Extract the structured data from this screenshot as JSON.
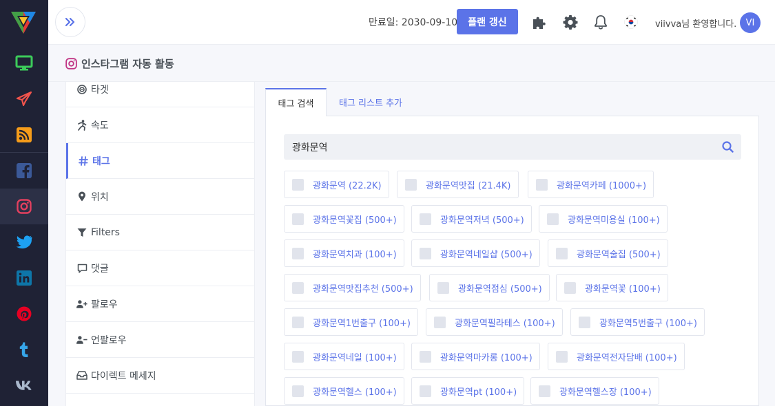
{
  "header": {
    "expiry_text": "만료일: 2030-09-10",
    "renew_label": "플랜 갱신",
    "welcome_text": "viivva님 환영합니다.",
    "avatar_initials": "VI"
  },
  "page": {
    "title": "인스타그램 자동 활동"
  },
  "subnav": [
    {
      "label": "타겟",
      "icon": "target-icon"
    },
    {
      "label": "속도",
      "icon": "running-icon"
    },
    {
      "label": "태그",
      "icon": "hashtag-icon",
      "active": true
    },
    {
      "label": "위치",
      "icon": "map-marker-icon"
    },
    {
      "label": "Filters",
      "icon": "filter-icon"
    },
    {
      "label": "댓글",
      "icon": "comment-icon"
    },
    {
      "label": "팔로우",
      "icon": "user-plus-icon"
    },
    {
      "label": "언팔로우",
      "icon": "user-minus-icon"
    },
    {
      "label": "다이렉트 메세지",
      "icon": "inbox-icon"
    }
  ],
  "tabs": [
    {
      "label": "태그 검색",
      "active": true
    },
    {
      "label": "태그 리스트 추가"
    }
  ],
  "search": {
    "value": "광화문역"
  },
  "tags": [
    "광화문역 (22.2K)",
    "광화문역맛집 (21.4K)",
    "광화문역카페 (1000+)",
    "광화문역꽃집 (500+)",
    "광화문역저녁 (500+)",
    "광화문역미용실 (100+)",
    "광화문역치과 (100+)",
    "광화문역네일샵 (500+)",
    "광화문역술집 (500+)",
    "광화문역맛집추천 (500+)",
    "광화문역점심 (500+)",
    "광화문역꽃 (100+)",
    "광화문역1번출구 (100+)",
    "광화문역필라테스 (100+)",
    "광화문역5번출구 (100+)",
    "광화문역네일 (100+)",
    "광화문역마카롱 (100+)",
    "광화문역전자담배 (100+)",
    "광화문역헬스 (100+)",
    "광화문역pt (100+)",
    "광화문역헬스장 (100+)"
  ],
  "colors": {
    "accent": "#5b73e8",
    "rail": "#1f2235",
    "instagram": "#e4405f"
  }
}
